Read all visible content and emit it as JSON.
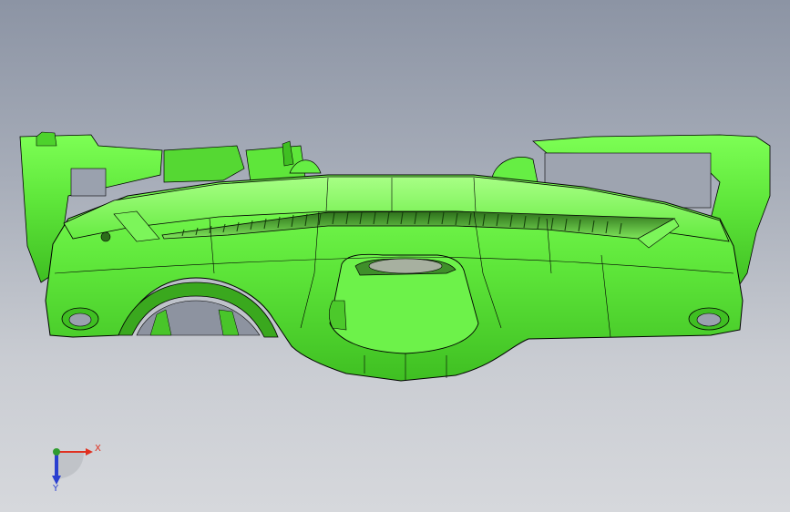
{
  "viewport": {
    "background_top": "#8c94a4",
    "background_bottom": "#d6d8dc",
    "model": {
      "part": "instrument-panel",
      "color": "#5ee63a",
      "edge_color": "#000000"
    },
    "triad": {
      "x_label": "X",
      "y_label": "Y",
      "x_color": "#e03020",
      "y_color": "#2a3fd0",
      "origin_color": "#2f9b2f"
    }
  }
}
